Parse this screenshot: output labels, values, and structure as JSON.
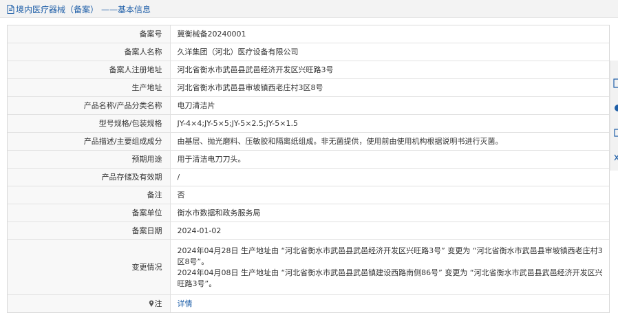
{
  "header": {
    "title": "境内医疗器械（备案）",
    "separator": "——",
    "subtitle": "基本信息"
  },
  "rows": [
    {
      "label": "备案号",
      "value": "冀衡械备20240001"
    },
    {
      "label": "备案人名称",
      "value": "久洋集团（河北）医疗设备有限公司"
    },
    {
      "label": "备案人注册地址",
      "value": "河北省衡水市武邑县武邑经济开发区兴旺路3号"
    },
    {
      "label": "生产地址",
      "value": "河北省衡水市武邑县审坡镇西老庄村3区8号"
    },
    {
      "label": "产品名称/产品分类名称",
      "value": "电刀清洁片"
    },
    {
      "label": "型号规格/包装规格",
      "value": "JY-4×4;JY-5×5;JY-5×2.5;JY-5×1.5"
    },
    {
      "label": "产品描述/主要组成成分",
      "value": "由基层、抛光磨料、压敏胶和隔离纸组成。非无菌提供，使用前由使用机构根据说明书进行灭菌。"
    },
    {
      "label": "预期用途",
      "value": "用于清洁电刀刀头。"
    },
    {
      "label": "产品存储及有效期",
      "value": "/"
    },
    {
      "label": "备注",
      "value": "否"
    },
    {
      "label": "备案单位",
      "value": "衡水市数据和政务服务局"
    },
    {
      "label": "备案日期",
      "value": "2024-01-02"
    }
  ],
  "changes": {
    "label": "变更情况",
    "entries": [
      "2024年04月28日 生产地址由 “河北省衡水市武邑县武邑经济开发区兴旺路3号” 变更为 “河北省衡水市武邑县审坡镇西老庄村3区8号”。",
      "2024年04月08日 生产地址由 “河北省衡水市武邑县武邑镇建设西路南侧86号” 变更为 “河北省衡水市武邑县武邑经济开发区兴旺路3号”。"
    ]
  },
  "note": {
    "label": "注",
    "link": "详情"
  },
  "colors": {
    "accent": "#1f5fa8",
    "label_bg": "#f8f8f8",
    "header_bg": "#f3f3f3"
  },
  "icons": {
    "title": "document-icon",
    "note": "location-pin-icon"
  }
}
